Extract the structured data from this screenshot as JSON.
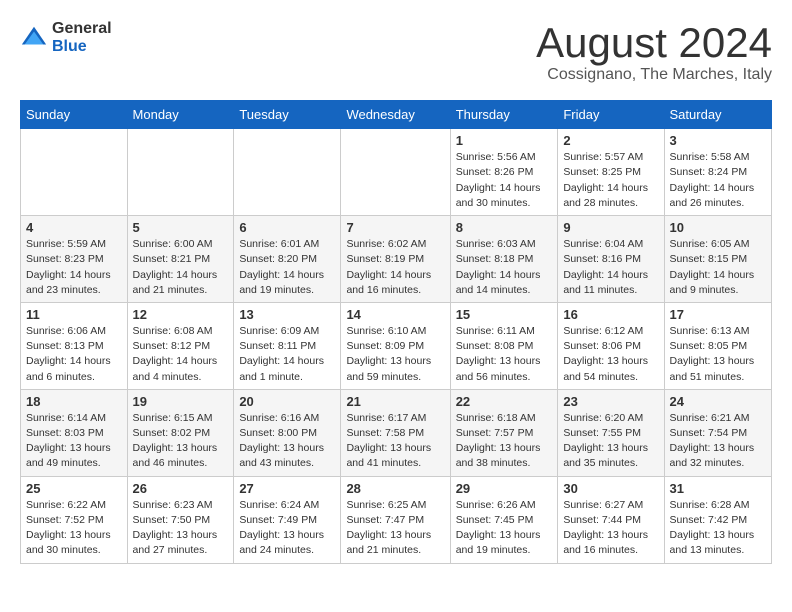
{
  "logo": {
    "general": "General",
    "blue": "Blue"
  },
  "title": "August 2024",
  "subtitle": "Cossignano, The Marches, Italy",
  "days_of_week": [
    "Sunday",
    "Monday",
    "Tuesday",
    "Wednesday",
    "Thursday",
    "Friday",
    "Saturday"
  ],
  "weeks": [
    [
      {
        "day": "",
        "info": ""
      },
      {
        "day": "",
        "info": ""
      },
      {
        "day": "",
        "info": ""
      },
      {
        "day": "",
        "info": ""
      },
      {
        "day": "1",
        "info": "Sunrise: 5:56 AM\nSunset: 8:26 PM\nDaylight: 14 hours\nand 30 minutes."
      },
      {
        "day": "2",
        "info": "Sunrise: 5:57 AM\nSunset: 8:25 PM\nDaylight: 14 hours\nand 28 minutes."
      },
      {
        "day": "3",
        "info": "Sunrise: 5:58 AM\nSunset: 8:24 PM\nDaylight: 14 hours\nand 26 minutes."
      }
    ],
    [
      {
        "day": "4",
        "info": "Sunrise: 5:59 AM\nSunset: 8:23 PM\nDaylight: 14 hours\nand 23 minutes."
      },
      {
        "day": "5",
        "info": "Sunrise: 6:00 AM\nSunset: 8:21 PM\nDaylight: 14 hours\nand 21 minutes."
      },
      {
        "day": "6",
        "info": "Sunrise: 6:01 AM\nSunset: 8:20 PM\nDaylight: 14 hours\nand 19 minutes."
      },
      {
        "day": "7",
        "info": "Sunrise: 6:02 AM\nSunset: 8:19 PM\nDaylight: 14 hours\nand 16 minutes."
      },
      {
        "day": "8",
        "info": "Sunrise: 6:03 AM\nSunset: 8:18 PM\nDaylight: 14 hours\nand 14 minutes."
      },
      {
        "day": "9",
        "info": "Sunrise: 6:04 AM\nSunset: 8:16 PM\nDaylight: 14 hours\nand 11 minutes."
      },
      {
        "day": "10",
        "info": "Sunrise: 6:05 AM\nSunset: 8:15 PM\nDaylight: 14 hours\nand 9 minutes."
      }
    ],
    [
      {
        "day": "11",
        "info": "Sunrise: 6:06 AM\nSunset: 8:13 PM\nDaylight: 14 hours\nand 6 minutes."
      },
      {
        "day": "12",
        "info": "Sunrise: 6:08 AM\nSunset: 8:12 PM\nDaylight: 14 hours\nand 4 minutes."
      },
      {
        "day": "13",
        "info": "Sunrise: 6:09 AM\nSunset: 8:11 PM\nDaylight: 14 hours\nand 1 minute."
      },
      {
        "day": "14",
        "info": "Sunrise: 6:10 AM\nSunset: 8:09 PM\nDaylight: 13 hours\nand 59 minutes."
      },
      {
        "day": "15",
        "info": "Sunrise: 6:11 AM\nSunset: 8:08 PM\nDaylight: 13 hours\nand 56 minutes."
      },
      {
        "day": "16",
        "info": "Sunrise: 6:12 AM\nSunset: 8:06 PM\nDaylight: 13 hours\nand 54 minutes."
      },
      {
        "day": "17",
        "info": "Sunrise: 6:13 AM\nSunset: 8:05 PM\nDaylight: 13 hours\nand 51 minutes."
      }
    ],
    [
      {
        "day": "18",
        "info": "Sunrise: 6:14 AM\nSunset: 8:03 PM\nDaylight: 13 hours\nand 49 minutes."
      },
      {
        "day": "19",
        "info": "Sunrise: 6:15 AM\nSunset: 8:02 PM\nDaylight: 13 hours\nand 46 minutes."
      },
      {
        "day": "20",
        "info": "Sunrise: 6:16 AM\nSunset: 8:00 PM\nDaylight: 13 hours\nand 43 minutes."
      },
      {
        "day": "21",
        "info": "Sunrise: 6:17 AM\nSunset: 7:58 PM\nDaylight: 13 hours\nand 41 minutes."
      },
      {
        "day": "22",
        "info": "Sunrise: 6:18 AM\nSunset: 7:57 PM\nDaylight: 13 hours\nand 38 minutes."
      },
      {
        "day": "23",
        "info": "Sunrise: 6:20 AM\nSunset: 7:55 PM\nDaylight: 13 hours\nand 35 minutes."
      },
      {
        "day": "24",
        "info": "Sunrise: 6:21 AM\nSunset: 7:54 PM\nDaylight: 13 hours\nand 32 minutes."
      }
    ],
    [
      {
        "day": "25",
        "info": "Sunrise: 6:22 AM\nSunset: 7:52 PM\nDaylight: 13 hours\nand 30 minutes."
      },
      {
        "day": "26",
        "info": "Sunrise: 6:23 AM\nSunset: 7:50 PM\nDaylight: 13 hours\nand 27 minutes."
      },
      {
        "day": "27",
        "info": "Sunrise: 6:24 AM\nSunset: 7:49 PM\nDaylight: 13 hours\nand 24 minutes."
      },
      {
        "day": "28",
        "info": "Sunrise: 6:25 AM\nSunset: 7:47 PM\nDaylight: 13 hours\nand 21 minutes."
      },
      {
        "day": "29",
        "info": "Sunrise: 6:26 AM\nSunset: 7:45 PM\nDaylight: 13 hours\nand 19 minutes."
      },
      {
        "day": "30",
        "info": "Sunrise: 6:27 AM\nSunset: 7:44 PM\nDaylight: 13 hours\nand 16 minutes."
      },
      {
        "day": "31",
        "info": "Sunrise: 6:28 AM\nSunset: 7:42 PM\nDaylight: 13 hours\nand 13 minutes."
      }
    ]
  ]
}
